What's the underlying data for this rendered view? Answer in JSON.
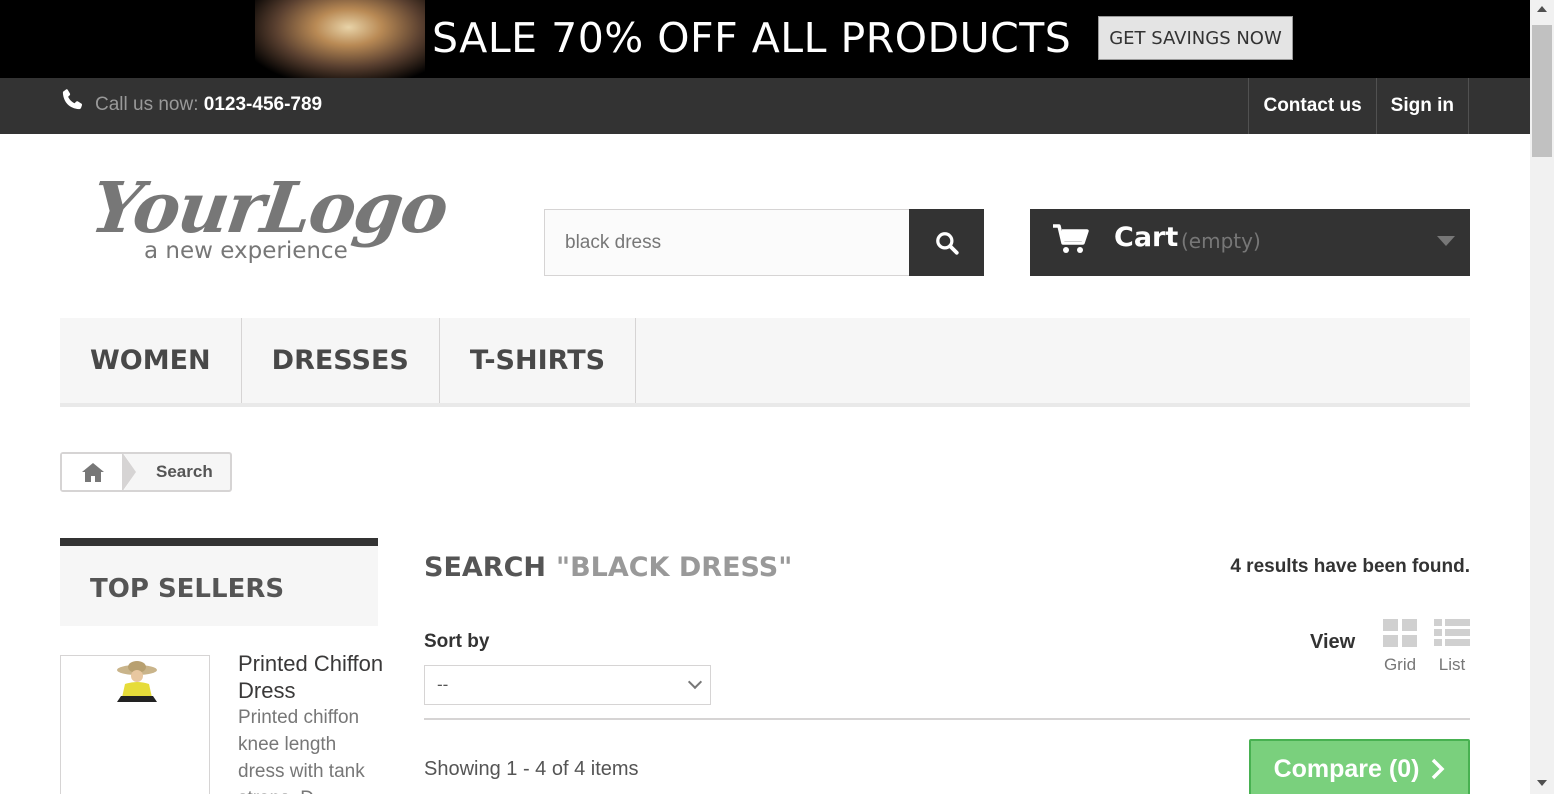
{
  "banner": {
    "text": "SALE 70% OFF ALL PRODUCTS",
    "button": "GET SAVINGS NOW"
  },
  "topnav": {
    "call_prefix": "Call us now: ",
    "phone": "0123-456-789",
    "links": [
      "Contact us",
      "Sign in"
    ]
  },
  "logo": {
    "main": "YourLogo",
    "tagline": "a new experience"
  },
  "search": {
    "value": "black dress",
    "icon": "search-icon"
  },
  "cart": {
    "label": "Cart",
    "status": "(empty)",
    "icon": "cart-icon"
  },
  "menu": {
    "items": [
      "WOMEN",
      "DRESSES",
      "T-SHIRTS"
    ]
  },
  "breadcrumb": {
    "home_icon": "home-icon",
    "current": "Search"
  },
  "sidebar": {
    "heading": "TOP SELLERS",
    "product": {
      "title": "Printed Chiffon Dress",
      "description": "Printed chiffon knee length dress with tank straps. D"
    }
  },
  "main": {
    "heading": "SEARCH",
    "query": "\"BLACK DRESS\"",
    "results": "4 results have been found.",
    "sort_label": "Sort by",
    "sort_value": "--",
    "view_label": "View",
    "view_grid": "Grid",
    "view_list": "List",
    "showing": "Showing 1 - 4 of 4 items",
    "compare": "Compare (0)"
  },
  "colors": {
    "dark": "#333333",
    "banner_bg": "#000000",
    "compare_green": "#7ad07d",
    "menu_bg": "#f6f6f6"
  }
}
